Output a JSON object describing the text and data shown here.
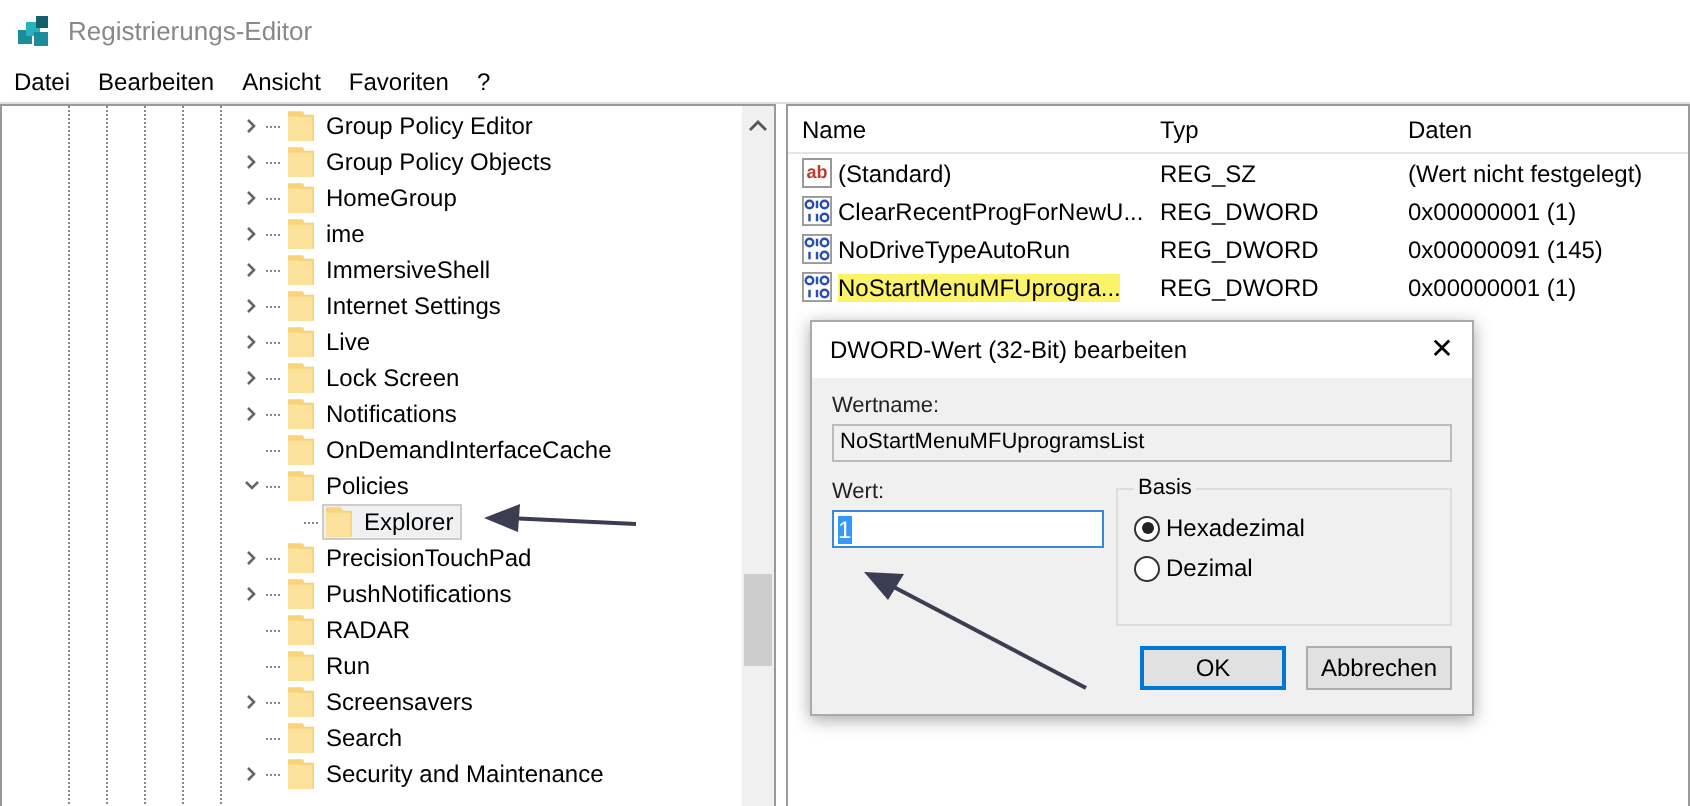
{
  "window": {
    "title": "Registrierungs-Editor"
  },
  "menu": [
    "Datei",
    "Bearbeiten",
    "Ansicht",
    "Favoriten",
    "?"
  ],
  "tree": [
    {
      "label": "Group Policy Editor",
      "expanded": false,
      "selected": false
    },
    {
      "label": "Group Policy Objects",
      "expanded": false,
      "selected": false
    },
    {
      "label": "HomeGroup",
      "expanded": false,
      "selected": false
    },
    {
      "label": "ime",
      "expanded": false,
      "selected": false
    },
    {
      "label": "ImmersiveShell",
      "expanded": false,
      "selected": false
    },
    {
      "label": "Internet Settings",
      "expanded": false,
      "selected": false
    },
    {
      "label": "Live",
      "expanded": false,
      "selected": false
    },
    {
      "label": "Lock Screen",
      "expanded": false,
      "selected": false
    },
    {
      "label": "Notifications",
      "expanded": false,
      "selected": false
    },
    {
      "label": "OnDemandInterfaceCache",
      "selected": false
    },
    {
      "label": "Policies",
      "expanded": true,
      "selected": false,
      "children": [
        {
          "label": "Explorer",
          "selected": true
        }
      ]
    },
    {
      "label": "PrecisionTouchPad",
      "expanded": false,
      "selected": false
    },
    {
      "label": "PushNotifications",
      "expanded": false,
      "selected": false
    },
    {
      "label": "RADAR",
      "selected": false
    },
    {
      "label": "Run",
      "selected": false
    },
    {
      "label": "Screensavers",
      "expanded": false,
      "selected": false
    },
    {
      "label": "Search",
      "selected": false
    },
    {
      "label": "Security and Maintenance",
      "expanded": false,
      "selected": false
    }
  ],
  "values": {
    "columns": [
      "Name",
      "Typ",
      "Daten"
    ],
    "rows": [
      {
        "kind": "string",
        "icon_text": "ab",
        "name": "(Standard)",
        "type": "REG_SZ",
        "data": "(Wert nicht festgelegt)",
        "highlighted": false
      },
      {
        "kind": "binary",
        "name": "ClearRecentProgForNewU...",
        "type": "REG_DWORD",
        "data": "0x00000001 (1)",
        "highlighted": false
      },
      {
        "kind": "binary",
        "name": "NoDriveTypeAutoRun",
        "type": "REG_DWORD",
        "data": "0x00000091 (145)",
        "highlighted": false
      },
      {
        "kind": "binary",
        "name": "NoStartMenuMFUprogra...",
        "type": "REG_DWORD",
        "data": "0x00000001 (1)",
        "highlighted": true
      }
    ]
  },
  "dialog": {
    "title": "DWORD-Wert (32-Bit) bearbeiten",
    "close": "✕",
    "name_label": "Wertname:",
    "name_value": "NoStartMenuMFUprogramsList",
    "value_label": "Wert:",
    "value": "1",
    "base_label": "Basis",
    "bases": [
      {
        "label": "Hexadezimal",
        "selected": true
      },
      {
        "label": "Dezimal",
        "selected": false
      }
    ],
    "buttons": [
      {
        "label": "OK",
        "default": true
      },
      {
        "label": "Abbrechen",
        "default": false
      }
    ]
  }
}
